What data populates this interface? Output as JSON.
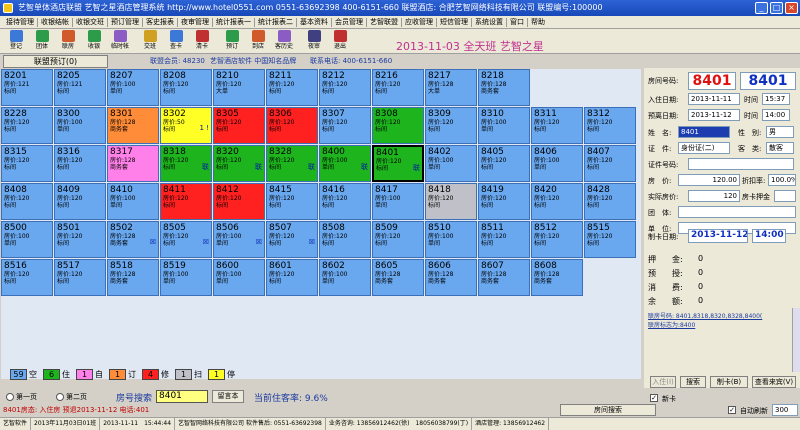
{
  "window": {
    "title": "艺智单体酒店联盟 艺智之星酒店管理系统 http://www.hotel0551.com 0551-63692398 400-6151-660 联盟酒店: 合肥艺智网络科技有限公司 联盟编号:100000",
    "min": "_",
    "max": "□",
    "close": "×"
  },
  "menu": [
    "接待管理",
    "收银结帐",
    "收银交班",
    "预订管理",
    "客史报表",
    "夜审管理",
    "统计报表一",
    "统计报表二",
    "基本资料",
    "会员管理",
    "艺智联盟",
    "应收管理",
    "短信管理",
    "系统设置",
    "窗口",
    "帮助"
  ],
  "toolbar": [
    {
      "label": "登记",
      "icon": "register-icon",
      "color": "#3b78d8"
    },
    {
      "label": "团体",
      "icon": "group-icon",
      "color": "#2c9b4a"
    },
    {
      "label": "联房",
      "icon": "link-room-icon",
      "color": "#d05a2a"
    },
    {
      "label": "收银",
      "icon": "cashier-icon",
      "color": "#2c9b4a"
    },
    {
      "label": "临时帐",
      "icon": "temp-bill-icon",
      "color": "#8a5cc4"
    },
    {
      "label": "交班",
      "icon": "shift-icon",
      "color": "#d0a020"
    },
    {
      "label": "查卡",
      "icon": "check-card-icon",
      "color": "#3b78d8"
    },
    {
      "label": "清卡",
      "icon": "clear-card-icon",
      "color": "#c03030"
    },
    {
      "label": "预订",
      "icon": "booking-icon",
      "color": "#2c9b4a"
    },
    {
      "label": "到店",
      "icon": "arrival-icon",
      "color": "#d05a2a"
    },
    {
      "label": "客历史",
      "icon": "history-icon",
      "color": "#8a5cc4"
    },
    {
      "label": "夜审",
      "icon": "night-audit-icon",
      "color": "#404080"
    },
    {
      "label": "退出",
      "icon": "exit-icon",
      "color": "#c03030"
    }
  ],
  "banner": {
    "date": "2013-11-03 全天班 艺智之星"
  },
  "infobar": {
    "tab": "联盟预订(0)",
    "members": "联盟会员: 48230",
    "brand": "艺智酒店软件 中国知名品牌",
    "phone": "联系电话: 400-6151-660"
  },
  "rooms": [
    {
      "n": "8201",
      "l2": "房价:121",
      "l3": "标间",
      "s": "vacant"
    },
    {
      "n": "8205",
      "l2": "房价:121",
      "l3": "标间",
      "s": "vacant"
    },
    {
      "n": "8207",
      "l2": "房价:100",
      "l3": "单间",
      "s": "vacant"
    },
    {
      "n": "8208",
      "l2": "房价:120",
      "l3": "标间",
      "s": "vacant"
    },
    {
      "n": "8210",
      "l2": "房价:120",
      "l3": "大单",
      "s": "vacant"
    },
    {
      "n": "8211",
      "l2": "房价:120",
      "l3": "标间",
      "s": "vacant"
    },
    {
      "n": "8212",
      "l2": "房价:120",
      "l3": "标间",
      "s": "vacant"
    },
    {
      "n": "8216",
      "l2": "房价:120",
      "l3": "标间",
      "s": "vacant"
    },
    {
      "n": "8217",
      "l2": "房价:128",
      "l3": "大单",
      "s": "vacant"
    },
    {
      "n": "8218",
      "l2": "房价:128",
      "l3": "商务套",
      "s": "vacant"
    },
    {
      "n": "8228",
      "l2": "房价:120",
      "l3": "标间",
      "s": "vacant"
    },
    {
      "n": "8300",
      "l2": "房价:100",
      "l3": "单间",
      "s": "vacant"
    },
    {
      "n": "8301",
      "l2": "房价:128",
      "l3": "商务套",
      "s": "booked"
    },
    {
      "n": "8302",
      "l2": "房价:50",
      "l3": "标间",
      "s": "reserved",
      "m": "1 !"
    },
    {
      "n": "8305",
      "l2": "房价:120",
      "l3": "标间",
      "s": "repair"
    },
    {
      "n": "8306",
      "l2": "房价:120",
      "l3": "标间",
      "s": "repair"
    },
    {
      "n": "8307",
      "l2": "房价:120",
      "l3": "标间",
      "s": "vacant"
    },
    {
      "n": "8308",
      "l2": "房价:120",
      "l3": "标间",
      "s": "occupied"
    },
    {
      "n": "8309",
      "l2": "房价:120",
      "l3": "标间",
      "s": "vacant"
    },
    {
      "n": "8310",
      "l2": "房价:100",
      "l3": "单间",
      "s": "vacant"
    },
    {
      "n": "8311",
      "l2": "房价:120",
      "l3": "标间",
      "s": "vacant"
    },
    {
      "n": "8312",
      "l2": "房价:120",
      "l3": "标间",
      "s": "vacant"
    },
    {
      "n": "8315",
      "l2": "房价:120",
      "l3": "标间",
      "s": "vacant"
    },
    {
      "n": "8316",
      "l2": "房价:120",
      "l3": "标间",
      "s": "vacant"
    },
    {
      "n": "8317",
      "l2": "房价:128",
      "l3": "商务套",
      "s": "vacant-dirty"
    },
    {
      "n": "8318",
      "l2": "房价:120",
      "l3": "标间",
      "s": "occupied",
      "m": "联"
    },
    {
      "n": "8320",
      "l2": "房价:120",
      "l3": "标间",
      "s": "occupied",
      "m": "联"
    },
    {
      "n": "8328",
      "l2": "房价:120",
      "l3": "标间",
      "s": "occupied",
      "m": "联"
    },
    {
      "n": "8400",
      "l2": "房价:100",
      "l3": "单间",
      "s": "occupied",
      "m": "联"
    },
    {
      "n": "8401",
      "l2": "房价:120",
      "l3": "标间",
      "s": "selected",
      "m": "联"
    },
    {
      "n": "8402",
      "l2": "房价:100",
      "l3": "单间",
      "s": "vacant"
    },
    {
      "n": "8405",
      "l2": "房价:120",
      "l3": "标间",
      "s": "vacant"
    },
    {
      "n": "8406",
      "l2": "房价:100",
      "l3": "单间",
      "s": "vacant"
    },
    {
      "n": "8407",
      "l2": "房价:120",
      "l3": "标间",
      "s": "vacant"
    },
    {
      "n": "8408",
      "l2": "房价:120",
      "l3": "标间",
      "s": "vacant"
    },
    {
      "n": "8409",
      "l2": "房价:120",
      "l3": "标间",
      "s": "vacant"
    },
    {
      "n": "8410",
      "l2": "房价:100",
      "l3": "单间",
      "s": "vacant"
    },
    {
      "n": "8411",
      "l2": "房价:120",
      "l3": "标间",
      "s": "repair"
    },
    {
      "n": "8412",
      "l2": "房价:120",
      "l3": "标间",
      "s": "repair"
    },
    {
      "n": "8415",
      "l2": "房价:120",
      "l3": "标间",
      "s": "vacant"
    },
    {
      "n": "8416",
      "l2": "房价:120",
      "l3": "标间",
      "s": "vacant"
    },
    {
      "n": "8417",
      "l2": "房价:100",
      "l3": "单间",
      "s": "vacant"
    },
    {
      "n": "8418",
      "l2": "房价:120",
      "l3": "标间",
      "s": "dirty"
    },
    {
      "n": "8419",
      "l2": "房价:120",
      "l3": "标间",
      "s": "vacant"
    },
    {
      "n": "8420",
      "l2": "房价:120",
      "l3": "标间",
      "s": "vacant"
    },
    {
      "n": "8428",
      "l2": "房价:120",
      "l3": "标间",
      "s": "vacant"
    },
    {
      "n": "8500",
      "l2": "房价:100",
      "l3": "单间",
      "s": "vacant"
    },
    {
      "n": "8501",
      "l2": "房价:120",
      "l3": "标间",
      "s": "vacant"
    },
    {
      "n": "8502",
      "l2": "房价:128",
      "l3": "商务套",
      "s": "vacant",
      "m": "☒"
    },
    {
      "n": "8505",
      "l2": "房价:120",
      "l3": "标间",
      "s": "vacant",
      "m": "☒"
    },
    {
      "n": "8506",
      "l2": "房价:100",
      "l3": "单间",
      "s": "vacant",
      "m": "☒"
    },
    {
      "n": "8507",
      "l2": "房价:120",
      "l3": "标间",
      "s": "vacant",
      "m": "☒"
    },
    {
      "n": "8508",
      "l2": "房价:120",
      "l3": "标间",
      "s": "vacant"
    },
    {
      "n": "8509",
      "l2": "房价:120",
      "l3": "标间",
      "s": "vacant"
    },
    {
      "n": "8510",
      "l2": "房价:100",
      "l3": "单间",
      "s": "vacant"
    },
    {
      "n": "8511",
      "l2": "房价:120",
      "l3": "标间",
      "s": "vacant"
    },
    {
      "n": "8512",
      "l2": "房价:120",
      "l3": "标间",
      "s": "vacant"
    },
    {
      "n": "8515",
      "l2": "房价:120",
      "l3": "标间",
      "s": "vacant"
    },
    {
      "n": "8516",
      "l2": "房价:120",
      "l3": "标间",
      "s": "vacant"
    },
    {
      "n": "8517",
      "l2": "房价:120",
      "l3": "标间",
      "s": "vacant"
    },
    {
      "n": "8518",
      "l2": "房价:128",
      "l3": "商务套",
      "s": "vacant"
    },
    {
      "n": "8519",
      "l2": "房价:100",
      "l3": "单间",
      "s": "vacant"
    },
    {
      "n": "8600",
      "l2": "房价:100",
      "l3": "单间",
      "s": "vacant"
    },
    {
      "n": "8601",
      "l2": "房价:120",
      "l3": "标间",
      "s": "vacant"
    },
    {
      "n": "8602",
      "l2": "房价:100",
      "l3": "单间",
      "s": "vacant"
    },
    {
      "n": "8605",
      "l2": "房价:128",
      "l3": "商务套",
      "s": "vacant"
    },
    {
      "n": "8606",
      "l2": "房价:128",
      "l3": "商务套",
      "s": "vacant"
    },
    {
      "n": "8607",
      "l2": "房价:128",
      "l3": "商务套",
      "s": "vacant"
    },
    {
      "n": "8608",
      "l2": "房价:128",
      "l3": "商务套",
      "s": "vacant"
    }
  ],
  "legend": [
    {
      "count": "59",
      "label": "空",
      "color": "#69a7ee"
    },
    {
      "count": "6",
      "label": "住",
      "color": "#1db41d"
    },
    {
      "count": "1",
      "label": "自",
      "color": "#ff80e8"
    },
    {
      "count": "1",
      "label": "订",
      "color": "#ff8c38"
    },
    {
      "count": "4",
      "label": "修",
      "color": "#ff2020"
    },
    {
      "count": "1",
      "label": "扫",
      "color": "#c0c0c8"
    },
    {
      "count": "1",
      "label": "停",
      "color": "#ffff26"
    }
  ],
  "pager": {
    "page1": "第一页",
    "page2": "第二页",
    "search_label": "房号搜索",
    "search_value": "8401",
    "msg_btn": "留言本",
    "occupancy": "当前住客率: 9.6%"
  },
  "notice": "8401房态: 入住房 预退2013-11-12 电话:401",
  "panel": {
    "room_label": "房间号码:",
    "room_no": "8401",
    "room_no2": "8401",
    "checkin_label": "入住日期:",
    "checkin_date": "2013-11-11",
    "checkin_time_label": "时间",
    "checkin_time": "15:37",
    "checkout_label": "预离日期:",
    "checkout_date": "2013-11-12",
    "checkout_time_label": "时间",
    "checkout_time": "14:00",
    "name_label": "姓　名:",
    "name_value": "8401",
    "gender_label": "性　别:",
    "gender_value": "男",
    "id_label": "证　件:",
    "id_value": "身份证(二)",
    "guest_type_label": "客　类:",
    "guest_type_value": "散客",
    "id_no_label": "证件号码:",
    "price_label": "房　价:",
    "price_value": "120.00",
    "discount_label": "折扣率:",
    "discount_value": "100.0%",
    "actual_label": "实际房价:",
    "actual_value": "120",
    "deposit_label": "房卡押金",
    "group_label": "团　体:",
    "unit_label": "单　位:",
    "card_date_label": "制卡日期:",
    "card_date": "2013-11-12",
    "card_time": "14:00",
    "deposit2_label": "押　　金:",
    "deposit2_value": "0",
    "prepaid_label": "预　　授:",
    "prepaid_value": "0",
    "consume_label": "消　　费:",
    "consume_value": "0",
    "balance_label": "余　　额:",
    "balance_value": "0",
    "link_rooms": "联房号码: 8401,8318,8320,8328,8400(",
    "link_remark": "联房标志为:8400",
    "btn_checkin": "入住(I)",
    "btn_search": "搜索",
    "btn_makecard": "制卡(B)",
    "btn_settings": "查看来宾(V)",
    "room_search": "房间搜索",
    "new_card": "新卡",
    "auto_refresh": "自动刷新",
    "refresh_val": "300"
  },
  "statusbar": [
    "艺智软件",
    "2013年11月03日01班",
    "2013-11-11　15:44:44",
    "艺智智网络科技有限公司 软件售后: 0551-63692398",
    "业务咨询: 13856912462(徐)　18056038799(丁)",
    "酒店管理: 13856912462"
  ]
}
